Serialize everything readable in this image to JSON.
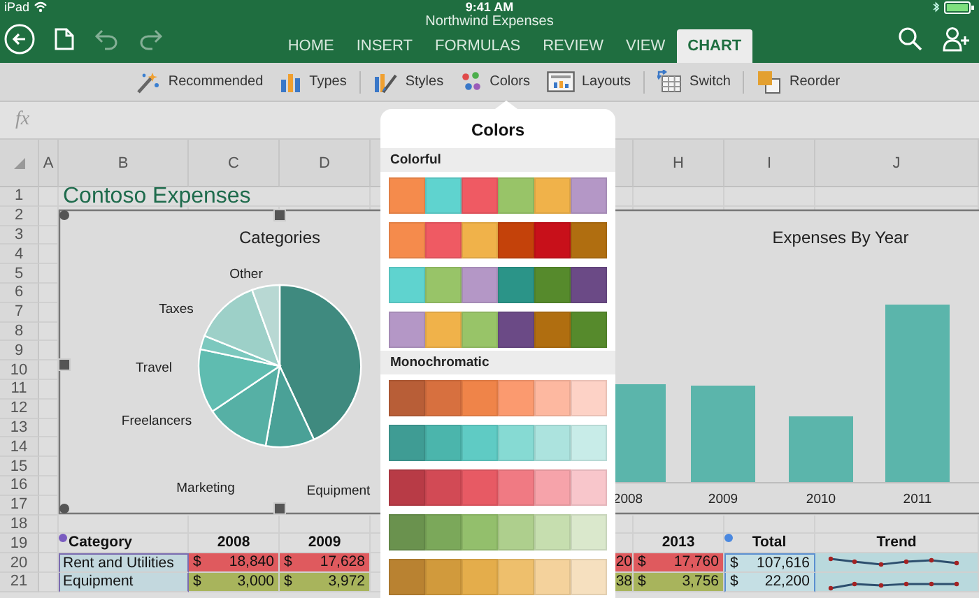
{
  "status_bar": {
    "carrier": "iPad",
    "time": "9:41 AM"
  },
  "document_title": "Northwind Expenses",
  "history_buttons": [
    {
      "kind": "undo",
      "disabled": true
    },
    {
      "kind": "redo",
      "disabled": true
    }
  ],
  "tabs": [
    {
      "label": "HOME",
      "selected": false
    },
    {
      "label": "INSERT",
      "selected": false
    },
    {
      "label": "FORMULAS",
      "selected": false
    },
    {
      "label": "REVIEW",
      "selected": false
    },
    {
      "label": "VIEW",
      "selected": false
    },
    {
      "label": "CHART",
      "selected": true
    }
  ],
  "ribbon_groups": [
    {
      "items": [
        {
          "kind": "wand",
          "label": "Recommended"
        },
        {
          "kind": "bars",
          "label": "Types"
        }
      ]
    },
    {
      "items": [
        {
          "kind": "brush",
          "label": "Styles"
        },
        {
          "kind": "dots",
          "label": "Colors"
        },
        {
          "kind": "layout",
          "label": "Layouts"
        }
      ]
    },
    {
      "items": [
        {
          "kind": "switch",
          "label": "Switch"
        }
      ]
    },
    {
      "items": [
        {
          "kind": "reorder",
          "label": "Reorder"
        }
      ]
    }
  ],
  "formula_bar": {
    "label": "fx"
  },
  "column_headers": [
    "A",
    "B",
    "C",
    "D",
    "H",
    "I",
    "J"
  ],
  "row_numbers": [
    "1",
    "2",
    "3",
    "4",
    "5",
    "6",
    "7",
    "8",
    "9",
    "10",
    "11",
    "12",
    "13",
    "14",
    "15",
    "16",
    "17",
    "18",
    "19",
    "20",
    "21"
  ],
  "sheet_title": "Contoso Expenses",
  "pie_chart": {
    "title": "Categories",
    "labels": [
      "Other",
      "Taxes",
      "Travel",
      "Freelancers",
      "Marketing",
      "Equipment"
    ]
  },
  "bar_chart": {
    "title": "Expenses By Year",
    "categories": [
      "2008",
      "2009",
      "2010",
      "2011"
    ]
  },
  "table": {
    "header": {
      "category": "Category",
      "years": [
        "2008",
        "2009"
      ],
      "last_year": "2013",
      "total": "Total",
      "trend": "Trend"
    },
    "rows": [
      {
        "category": "Rent and Utilities",
        "color": "#df5a5e",
        "years": [
          {
            "currency": "$",
            "amount": "18,840"
          },
          {
            "currency": "$",
            "amount": "17,628"
          }
        ],
        "cut_value": "20",
        "last": {
          "currency": "$",
          "amount": "17,760"
        },
        "total": {
          "currency": "$",
          "amount": "107,616"
        }
      },
      {
        "category": "Equipment",
        "color": "#a8b45c",
        "years": [
          {
            "currency": "$",
            "amount": "3,000"
          },
          {
            "currency": "$",
            "amount": "3,972"
          }
        ],
        "cut_value": "38",
        "last": {
          "currency": "$",
          "amount": "3,756"
        },
        "total": {
          "currency": "$",
          "amount": "22,200"
        }
      }
    ]
  },
  "colors_popover": {
    "title": "Colors",
    "sections": [
      {
        "heading": "Colorful",
        "palettes": [
          {
            "swatches": [
              {
                "color": "#f58b4c"
              },
              {
                "color": "#5fd3cf"
              },
              {
                "color": "#ef5a63"
              },
              {
                "color": "#98c468"
              },
              {
                "color": "#f0b24a"
              },
              {
                "color": "#b497c6"
              }
            ]
          },
          {
            "swatches": [
              {
                "color": "#f58b4c"
              },
              {
                "color": "#ef5a63"
              },
              {
                "color": "#f0b24a"
              },
              {
                "color": "#c4420a"
              },
              {
                "color": "#c8101a"
              },
              {
                "color": "#b06e10"
              }
            ]
          },
          {
            "swatches": [
              {
                "color": "#5fd3cf"
              },
              {
                "color": "#98c468"
              },
              {
                "color": "#b497c6"
              },
              {
                "color": "#2b9488"
              },
              {
                "color": "#568a2c"
              },
              {
                "color": "#6b4a86"
              }
            ]
          },
          {
            "swatches": [
              {
                "color": "#b497c6"
              },
              {
                "color": "#f0b24a"
              },
              {
                "color": "#98c468"
              },
              {
                "color": "#6b4a86"
              },
              {
                "color": "#b06e10"
              },
              {
                "color": "#568a2c"
              }
            ]
          }
        ]
      },
      {
        "heading": "Monochromatic",
        "palettes": [
          {
            "swatches": [
              {
                "color": "#b85e37"
              },
              {
                "color": "#d7703f"
              },
              {
                "color": "#ef8449"
              },
              {
                "color": "#fb9a6f"
              },
              {
                "color": "#fdb8a0"
              },
              {
                "color": "#fdd2c6"
              }
            ]
          },
          {
            "swatches": [
              {
                "color": "#3f9c94"
              },
              {
                "color": "#4bb5ac"
              },
              {
                "color": "#5fcbc4"
              },
              {
                "color": "#86dad3"
              },
              {
                "color": "#ace3de"
              },
              {
                "color": "#c8ece8"
              }
            ]
          },
          {
            "swatches": [
              {
                "color": "#b83b46"
              },
              {
                "color": "#d24a55"
              },
              {
                "color": "#e75a64"
              },
              {
                "color": "#f07a83"
              },
              {
                "color": "#f6a3aa"
              },
              {
                "color": "#f8c6cb"
              }
            ]
          },
          {
            "swatches": [
              {
                "color": "#6a924e"
              },
              {
                "color": "#7ba85a"
              },
              {
                "color": "#93bf6c"
              },
              {
                "color": "#aecf8d"
              },
              {
                "color": "#c6deaf"
              },
              {
                "color": "#dae8cc"
              }
            ]
          },
          {
            "swatches": [
              {
                "color": "#b98231"
              },
              {
                "color": "#d19a3c"
              },
              {
                "color": "#e4ad4b"
              },
              {
                "color": "#eebf6c"
              },
              {
                "color": "#f4d29c"
              },
              {
                "color": "#f6e0bf"
              }
            ]
          }
        ]
      }
    ]
  }
}
